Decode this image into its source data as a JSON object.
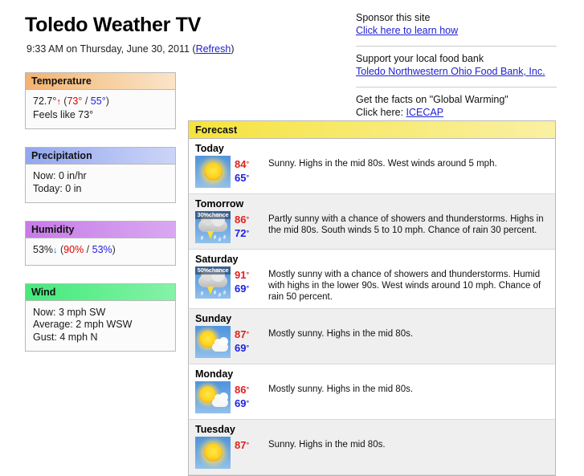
{
  "header": {
    "title": "Toledo Weather TV",
    "timestamp": "9:33 AM on Thursday, June 30, 2011 (",
    "refresh_label": "Refresh",
    "timestamp_close": ")"
  },
  "sponsors": [
    {
      "text": "Sponsor this site",
      "link": "Click here to learn how"
    },
    {
      "text": "Support your local food bank",
      "link": "Toledo Northwestern Ohio Food Bank, Inc."
    },
    {
      "text": "Get the facts on \"Global Warming\"",
      "prefix": "Click here: ",
      "link": "ICECAP"
    }
  ],
  "panels": {
    "temperature": {
      "title": "Temperature",
      "current": "72.7°",
      "trend_icon": "arrow-up-icon",
      "trend": "↑",
      "open_paren": " (",
      "high": "73°",
      "sep": " / ",
      "low": "55°",
      "close_paren": ")",
      "feels_like": "Feels like 73°"
    },
    "precipitation": {
      "title": "Precipitation",
      "now": "Now: 0 in/hr",
      "today": "Today: 0 in"
    },
    "humidity": {
      "title": "Humidity",
      "current": "53%",
      "trend_icon": "arrow-down-icon",
      "trend": "↓",
      "open_paren": " (",
      "high": "90%",
      "sep": " / ",
      "low": "53%",
      "close_paren": ")"
    },
    "wind": {
      "title": "Wind",
      "now": "Now: 3 mph SW",
      "average": "Average: 2 mph WSW",
      "gust": "Gust: 4 mph N"
    }
  },
  "forecast": {
    "title": "Forecast",
    "days": [
      {
        "day": "Today",
        "icon": "sunny-icon",
        "badge": "",
        "high": "84",
        "low": "65",
        "text": "Sunny. Highs in the mid 80s. West winds around 5 mph."
      },
      {
        "day": "Tomorrow",
        "icon": "thunderstorm-icon",
        "badge": "30%chance",
        "high": "86",
        "low": "72",
        "text": "Partly sunny with a chance of showers and thunderstorms. Highs in the mid 80s. South winds 5 to 10 mph. Chance of rain 30 percent."
      },
      {
        "day": "Saturday",
        "icon": "thunderstorm-icon",
        "badge": "50%chance",
        "high": "91",
        "low": "69",
        "text": "Mostly sunny with a chance of showers and thunderstorms. Humid with highs in the lower 90s. West winds around 10 mph. Chance of rain 50 percent."
      },
      {
        "day": "Sunday",
        "icon": "mostly-sunny-icon",
        "badge": "",
        "high": "87",
        "low": "69",
        "text": "Mostly sunny. Highs in the mid 80s."
      },
      {
        "day": "Monday",
        "icon": "mostly-sunny-icon",
        "badge": "",
        "high": "86",
        "low": "69",
        "text": "Mostly sunny. Highs in the mid 80s."
      },
      {
        "day": "Tuesday",
        "icon": "sunny-icon",
        "badge": "",
        "high": "87",
        "low": "",
        "text": "Sunny. Highs in the mid 80s."
      }
    ]
  },
  "colors": {
    "high_temp": "#e02020",
    "low_temp": "#2020e0",
    "link": "#2020d0",
    "temperature_header": "#f2b271",
    "precipitation_header": "#93a7ee",
    "humidity_header": "#c77ae8",
    "wind_header": "#46e97c",
    "forecast_header": "#f5e23c"
  }
}
